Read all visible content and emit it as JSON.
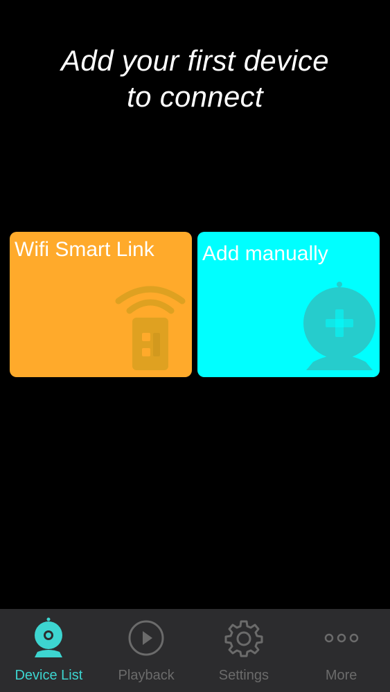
{
  "header": {
    "title_line1": "Add your first device",
    "title_line2": "to connect"
  },
  "cards": [
    {
      "label": "Wifi Smart Link",
      "icon": "wifi-remote-icon",
      "color": "#FFAA2B"
    },
    {
      "label": "Add manually",
      "icon": "camera-add-icon",
      "color": "#00FFFF"
    }
  ],
  "tabbar": {
    "active_color": "#3DD5D0",
    "inactive_color": "#6b6b6b",
    "tabs": [
      {
        "label": "Device List",
        "icon": "camera-icon",
        "active": true
      },
      {
        "label": "Playback",
        "icon": "play-icon",
        "active": false
      },
      {
        "label": "Settings",
        "icon": "gear-icon",
        "active": false
      },
      {
        "label": "More",
        "icon": "more-dots-icon",
        "active": false
      }
    ]
  }
}
